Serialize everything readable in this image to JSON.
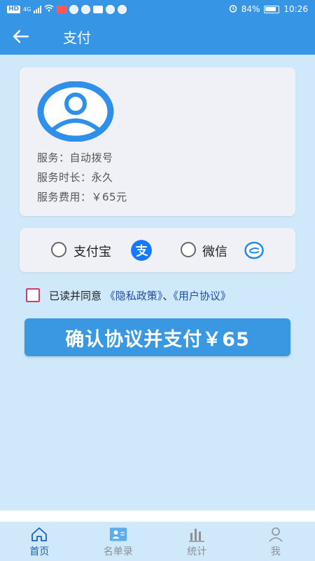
{
  "status_bar": {
    "network": "4G",
    "hd": "HD",
    "battery": "84%",
    "time": "10:26"
  },
  "header": {
    "title": "支付"
  },
  "service": {
    "name": "服务：自动拨号",
    "duration": "服务时长：永久",
    "fee": "服务费用：￥65元"
  },
  "payment": {
    "options": [
      {
        "label": "支付宝",
        "icon": "alipay-icon",
        "color": "#1677ff"
      },
      {
        "label": "微信",
        "icon": "wechat-icon",
        "color": "#1f8ae6"
      }
    ]
  },
  "agreement": {
    "prefix": "已读并同意",
    "privacy": "《隐私政策》",
    "separator": "、",
    "user": "《用户协议》"
  },
  "confirm_button": {
    "label": "确认协议并支付￥65"
  },
  "tabs": [
    {
      "label": "首页",
      "icon": "home-icon"
    },
    {
      "label": "名单录",
      "icon": "contacts-icon"
    },
    {
      "label": "统计",
      "icon": "chart-icon"
    },
    {
      "label": "我",
      "icon": "user-icon"
    }
  ],
  "colors": {
    "primary": "#3795e6",
    "background": "#cfe9fb",
    "link": "#1f4aa8",
    "active_tab": "#1a63b8"
  }
}
